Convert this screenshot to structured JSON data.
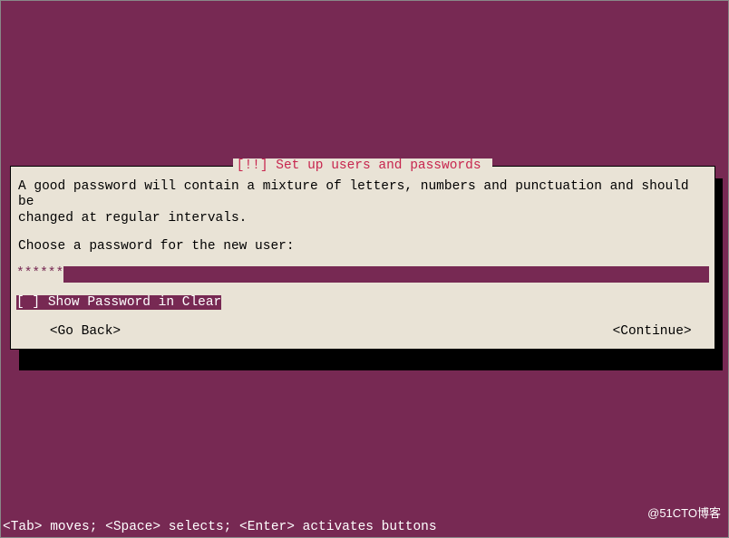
{
  "dialog": {
    "title_left": "[!!] ",
    "title_text": "Set up users and passwords",
    "body": "A good password will contain a mixture of letters, numbers and punctuation and should be\nchanged at regular intervals.",
    "prompt": "Choose a password for the new user:",
    "password_value": "******",
    "checkbox": {
      "box": "[ ]",
      "label": "Show Password in Clear"
    },
    "nav": {
      "back": "<Go Back>",
      "continue": "<Continue>"
    }
  },
  "footer_help": "<Tab> moves; <Space> selects; <Enter> activates buttons",
  "watermark": "@51CTO博客"
}
